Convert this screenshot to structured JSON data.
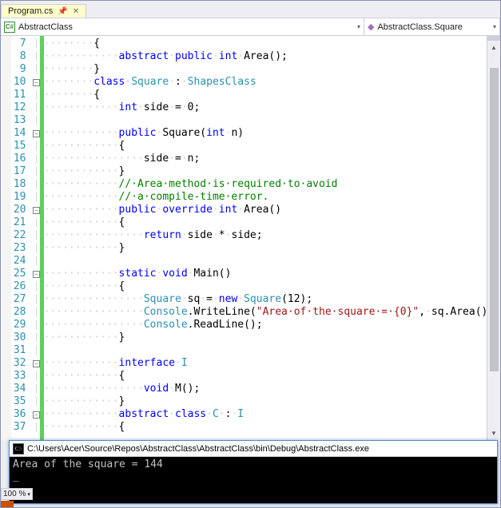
{
  "tab": {
    "filename": "Program.cs"
  },
  "nav": {
    "left": "AbstractClass",
    "right": "AbstractClass.Square"
  },
  "zoom": "100 %",
  "console": {
    "title": "C:\\Users\\Acer\\Source\\Repos\\AbstractClass\\AbstractClass\\bin\\Debug\\AbstractClass.exe",
    "output": "Area of the square = 144",
    "cursor": "_"
  },
  "code": {
    "lines": [
      7,
      8,
      9,
      10,
      11,
      12,
      13,
      14,
      15,
      16,
      17,
      18,
      19,
      20,
      21,
      22,
      23,
      24,
      25,
      26,
      27,
      28,
      29,
      30,
      31,
      32,
      33,
      34,
      35,
      36,
      37
    ],
    "fold_at": [
      10,
      14,
      20,
      25,
      32,
      36
    ],
    "tokens": {
      "l7": [
        {
          "t": "ws",
          "v": "········"
        },
        {
          "t": "",
          "v": "{"
        }
      ],
      "l8": [
        {
          "t": "ws",
          "v": "············"
        },
        {
          "t": "kw",
          "v": "abstract"
        },
        {
          "t": "ws",
          "v": "·"
        },
        {
          "t": "kw",
          "v": "public"
        },
        {
          "t": "ws",
          "v": "·"
        },
        {
          "t": "kw",
          "v": "int"
        },
        {
          "t": "ws",
          "v": "·"
        },
        {
          "t": "",
          "v": "Area();"
        }
      ],
      "l9": [
        {
          "t": "ws",
          "v": "········"
        },
        {
          "t": "",
          "v": "}"
        }
      ],
      "l10": [
        {
          "t": "ws",
          "v": "········"
        },
        {
          "t": "kw",
          "v": "class"
        },
        {
          "t": "ws",
          "v": "·"
        },
        {
          "t": "typ",
          "v": "Square"
        },
        {
          "t": "ws",
          "v": "·"
        },
        {
          "t": "",
          "v": ":"
        },
        {
          "t": "ws",
          "v": "·"
        },
        {
          "t": "typ",
          "v": "ShapesClass"
        }
      ],
      "l11": [
        {
          "t": "ws",
          "v": "········"
        },
        {
          "t": "",
          "v": "{"
        }
      ],
      "l12": [
        {
          "t": "ws",
          "v": "············"
        },
        {
          "t": "kw",
          "v": "int"
        },
        {
          "t": "ws",
          "v": "·"
        },
        {
          "t": "",
          "v": "side"
        },
        {
          "t": "ws",
          "v": "·"
        },
        {
          "t": "",
          "v": "="
        },
        {
          "t": "ws",
          "v": "·"
        },
        {
          "t": "",
          "v": "0;"
        }
      ],
      "l13": [
        {
          "t": "",
          "v": ""
        }
      ],
      "l14": [
        {
          "t": "ws",
          "v": "············"
        },
        {
          "t": "kw",
          "v": "public"
        },
        {
          "t": "ws",
          "v": "·"
        },
        {
          "t": "",
          "v": "Square("
        },
        {
          "t": "kw",
          "v": "int"
        },
        {
          "t": "ws",
          "v": "·"
        },
        {
          "t": "",
          "v": "n)"
        }
      ],
      "l15": [
        {
          "t": "ws",
          "v": "············"
        },
        {
          "t": "",
          "v": "{"
        }
      ],
      "l16": [
        {
          "t": "ws",
          "v": "················"
        },
        {
          "t": "",
          "v": "side"
        },
        {
          "t": "ws",
          "v": "·"
        },
        {
          "t": "",
          "v": "="
        },
        {
          "t": "ws",
          "v": "·"
        },
        {
          "t": "",
          "v": "n;"
        }
      ],
      "l17": [
        {
          "t": "ws",
          "v": "············"
        },
        {
          "t": "",
          "v": "}"
        }
      ],
      "l18": [
        {
          "t": "ws",
          "v": "············"
        },
        {
          "t": "cmt",
          "v": "//·Area·method·is·required·to·avoid"
        }
      ],
      "l19": [
        {
          "t": "ws",
          "v": "············"
        },
        {
          "t": "cmt",
          "v": "//·a·compile-time·error."
        }
      ],
      "l20": [
        {
          "t": "ws",
          "v": "············"
        },
        {
          "t": "kw",
          "v": "public"
        },
        {
          "t": "ws",
          "v": "·"
        },
        {
          "t": "kw",
          "v": "override"
        },
        {
          "t": "ws",
          "v": "·"
        },
        {
          "t": "kw",
          "v": "int"
        },
        {
          "t": "ws",
          "v": "·"
        },
        {
          "t": "",
          "v": "Area()"
        }
      ],
      "l21": [
        {
          "t": "ws",
          "v": "············"
        },
        {
          "t": "",
          "v": "{"
        }
      ],
      "l22": [
        {
          "t": "ws",
          "v": "················"
        },
        {
          "t": "kw",
          "v": "return"
        },
        {
          "t": "ws",
          "v": "·"
        },
        {
          "t": "",
          "v": "side"
        },
        {
          "t": "ws",
          "v": "·"
        },
        {
          "t": "",
          "v": "*"
        },
        {
          "t": "ws",
          "v": "·"
        },
        {
          "t": "",
          "v": "side;"
        }
      ],
      "l23": [
        {
          "t": "ws",
          "v": "············"
        },
        {
          "t": "",
          "v": "}"
        }
      ],
      "l24": [
        {
          "t": "",
          "v": ""
        }
      ],
      "l25": [
        {
          "t": "ws",
          "v": "············"
        },
        {
          "t": "kw",
          "v": "static"
        },
        {
          "t": "ws",
          "v": "·"
        },
        {
          "t": "kw",
          "v": "void"
        },
        {
          "t": "ws",
          "v": "·"
        },
        {
          "t": "",
          "v": "Main()"
        }
      ],
      "l26": [
        {
          "t": "ws",
          "v": "············"
        },
        {
          "t": "",
          "v": "{"
        }
      ],
      "l27": [
        {
          "t": "ws",
          "v": "················"
        },
        {
          "t": "typ",
          "v": "Square"
        },
        {
          "t": "ws",
          "v": "·"
        },
        {
          "t": "",
          "v": "sq"
        },
        {
          "t": "ws",
          "v": "·"
        },
        {
          "t": "",
          "v": "="
        },
        {
          "t": "ws",
          "v": "·"
        },
        {
          "t": "kw",
          "v": "new"
        },
        {
          "t": "ws",
          "v": "·"
        },
        {
          "t": "typ",
          "v": "Square"
        },
        {
          "t": "",
          "v": "(12);"
        }
      ],
      "l28": [
        {
          "t": "ws",
          "v": "················"
        },
        {
          "t": "typ",
          "v": "Console"
        },
        {
          "t": "",
          "v": ".WriteLine("
        },
        {
          "t": "str",
          "v": "\"Area·of·the·square·=·{0}\""
        },
        {
          "t": "",
          "v": ","
        },
        {
          "t": "ws",
          "v": "·"
        },
        {
          "t": "",
          "v": "sq.Area());"
        }
      ],
      "l29": [
        {
          "t": "ws",
          "v": "················"
        },
        {
          "t": "typ",
          "v": "Console"
        },
        {
          "t": "",
          "v": ".ReadLine();"
        }
      ],
      "l30": [
        {
          "t": "ws",
          "v": "············"
        },
        {
          "t": "",
          "v": "}"
        }
      ],
      "l31": [
        {
          "t": "",
          "v": ""
        }
      ],
      "l32": [
        {
          "t": "ws",
          "v": "············"
        },
        {
          "t": "kw",
          "v": "interface"
        },
        {
          "t": "ws",
          "v": "·"
        },
        {
          "t": "typ",
          "v": "I"
        }
      ],
      "l33": [
        {
          "t": "ws",
          "v": "············"
        },
        {
          "t": "",
          "v": "{"
        }
      ],
      "l34": [
        {
          "t": "ws",
          "v": "················"
        },
        {
          "t": "kw",
          "v": "void"
        },
        {
          "t": "ws",
          "v": "·"
        },
        {
          "t": "",
          "v": "M();"
        }
      ],
      "l35": [
        {
          "t": "ws",
          "v": "············"
        },
        {
          "t": "",
          "v": "}"
        }
      ],
      "l36": [
        {
          "t": "ws",
          "v": "············"
        },
        {
          "t": "kw",
          "v": "abstract"
        },
        {
          "t": "ws",
          "v": "·"
        },
        {
          "t": "kw",
          "v": "class"
        },
        {
          "t": "ws",
          "v": "·"
        },
        {
          "t": "typ",
          "v": "C"
        },
        {
          "t": "ws",
          "v": "·"
        },
        {
          "t": "",
          "v": ":"
        },
        {
          "t": "ws",
          "v": "·"
        },
        {
          "t": "typ",
          "v": "I"
        }
      ],
      "l37": [
        {
          "t": "ws",
          "v": "············"
        },
        {
          "t": "",
          "v": "{"
        }
      ]
    }
  }
}
